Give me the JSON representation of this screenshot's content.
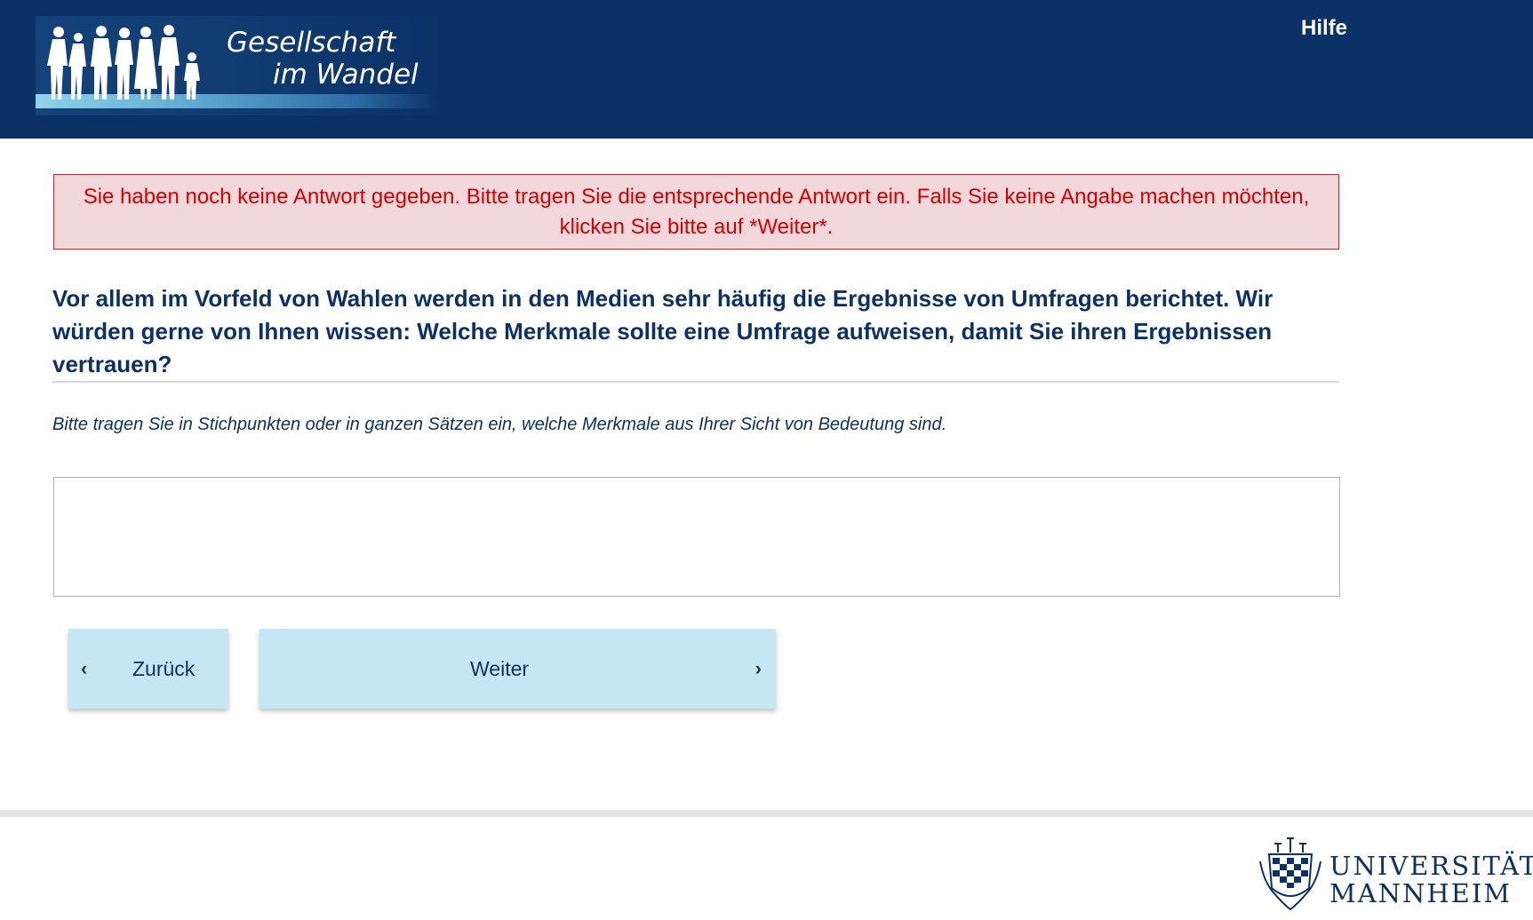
{
  "header": {
    "logo_line1": "Gesellschaft",
    "logo_line2": "im Wandel",
    "help_label": "Hilfe"
  },
  "error": {
    "message": "Sie haben noch keine Antwort gegeben. Bitte tragen Sie die entsprechende Antwort ein. Falls Sie keine Angabe machen möchten, klicken Sie bitte auf *Weiter*."
  },
  "question": {
    "text": "Vor allem im Vorfeld von Wahlen werden in den Medien sehr häufig die Ergebnisse von Umfragen berichtet. Wir würden gerne von Ihnen wissen: Welche Merkmale sollte eine Umfrage aufweisen, damit Sie ihren Ergebnissen vertrauen?",
    "instruction": "Bitte tragen Sie in Stichpunkten oder in ganzen Sätzen ein, welche Merkmale aus Ihrer Sicht von Bedeutung sind.",
    "answer_value": ""
  },
  "navigation": {
    "back_label": "Zurück",
    "next_label": "Weiter",
    "back_icon": "chevron-left-icon",
    "next_icon": "chevron-right-icon"
  },
  "footer": {
    "university_line1": "UNIVERSITÄT",
    "university_line2": "MANNHEIM"
  },
  "colors": {
    "header_bg": "#0b3166",
    "error_bg": "#f2d8da",
    "error_border": "#d81e1e",
    "error_text": "#d40000",
    "button_bg": "#c5e7f3",
    "text_primary": "#0b3166"
  }
}
